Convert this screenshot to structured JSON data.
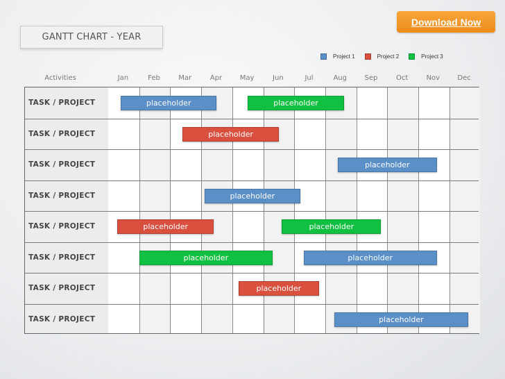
{
  "header": {
    "download_label": "Download Now",
    "title": "GANTT CHART - YEAR"
  },
  "colors": {
    "project1": "#5b8fc8",
    "project2": "#d9503f",
    "project3": "#10c141",
    "download_button": "#f39a2a"
  },
  "chart_data": {
    "type": "gantt",
    "title": "GANTT CHART - YEAR",
    "activities_header": "Activities",
    "months": [
      "Jan",
      "Feb",
      "Mar",
      "Apr",
      "May",
      "Jun",
      "Jul",
      "Aug",
      "Sep",
      "Oct",
      "Nov",
      "Dec"
    ],
    "legend": [
      {
        "key": "project1",
        "label": "Project 1"
      },
      {
        "key": "project2",
        "label": "Project 2"
      },
      {
        "key": "project3",
        "label": "Project 3"
      }
    ],
    "legend_position": "top-right",
    "rows": [
      {
        "label": "TASK / PROJECT",
        "bars": [
          {
            "project": "project1",
            "label": "placeholder",
            "start": 0.4,
            "end": 3.5
          },
          {
            "project": "project3",
            "label": "placeholder",
            "start": 4.5,
            "end": 7.6
          }
        ]
      },
      {
        "label": "TASK / PROJECT",
        "bars": [
          {
            "project": "project2",
            "label": "placeholder",
            "start": 2.4,
            "end": 5.5
          }
        ]
      },
      {
        "label": "TASK / PROJECT",
        "bars": [
          {
            "project": "project1",
            "label": "placeholder",
            "start": 7.4,
            "end": 10.6
          }
        ]
      },
      {
        "label": "TASK / PROJECT",
        "bars": [
          {
            "project": "project1",
            "label": "placeholder",
            "start": 3.1,
            "end": 6.2
          }
        ]
      },
      {
        "label": "TASK / PROJECT",
        "bars": [
          {
            "project": "project2",
            "label": "placeholder",
            "start": 0.3,
            "end": 3.4
          },
          {
            "project": "project3",
            "label": "placeholder",
            "start": 5.6,
            "end": 8.8
          }
        ]
      },
      {
        "label": "TASK / PROJECT",
        "bars": [
          {
            "project": "project3",
            "label": "placeholder",
            "start": 1.0,
            "end": 5.3
          },
          {
            "project": "project1",
            "label": "placeholder",
            "start": 6.3,
            "end": 10.6
          }
        ]
      },
      {
        "label": "TASK / PROJECT",
        "bars": [
          {
            "project": "project2",
            "label": "placeholder",
            "start": 4.2,
            "end": 6.8
          }
        ]
      },
      {
        "label": "TASK / PROJECT",
        "bars": [
          {
            "project": "project1",
            "label": "placeholder",
            "start": 7.3,
            "end": 11.6
          }
        ]
      }
    ]
  }
}
